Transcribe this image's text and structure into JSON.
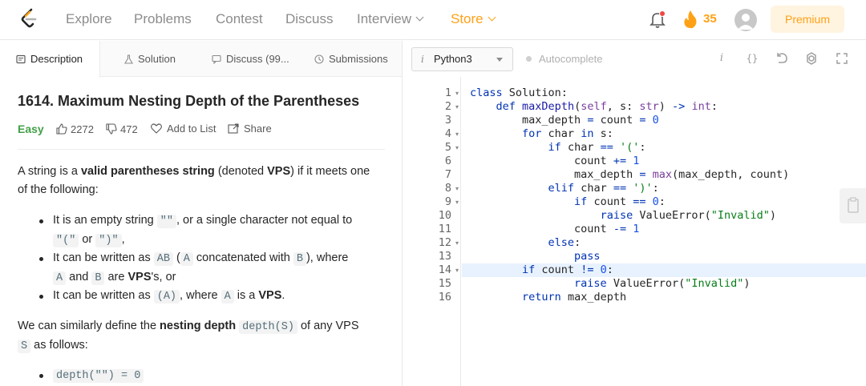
{
  "nav": {
    "items": [
      "Explore",
      "Problems",
      "Contest",
      "Discuss"
    ],
    "interview": "Interview",
    "store": "Store",
    "streak": "35",
    "premium": "Premium"
  },
  "tabs": {
    "description": "Description",
    "solution": "Solution",
    "discuss": "Discuss (99...",
    "submissions": "Submissions"
  },
  "problem": {
    "title": "1614. Maximum Nesting Depth of the Parentheses",
    "difficulty": "Easy",
    "likes": "2272",
    "dislikes": "472",
    "add_to_list": "Add to List",
    "share": "Share"
  },
  "description": {
    "p1_a": "A string is a ",
    "p1_b": "valid parentheses string",
    "p1_c": " (denoted ",
    "p1_d": "VPS",
    "p1_e": ") if it meets one of the following:",
    "b1_a": "It is an empty string ",
    "b1_code1": "\"\"",
    "b1_b": ", or a single character not equal to ",
    "b1_code2": "\"(\"",
    "b1_or": " or ",
    "b1_code3": "\")\"",
    "b1_end": ",",
    "b2_a": "It can be written as ",
    "b2_code1": "AB",
    "b2_b": " (",
    "b2_code2": "A",
    "b2_c": " concatenated with ",
    "b2_code3": "B",
    "b2_d": "), where ",
    "b2_code4": "A",
    "b2_and": " and ",
    "b2_code5": "B",
    "b2_e": " are ",
    "b2_vps": "VPS",
    "b2_f": "'s, or",
    "b3_a": "It can be written as ",
    "b3_code1": "(A)",
    "b3_b": ", where ",
    "b3_code2": "A",
    "b3_c": " is a ",
    "b3_vps": "VPS",
    "b3_d": ".",
    "p2_a": "We can similarly define the ",
    "p2_b": "nesting depth",
    "p2_code1": "depth(S)",
    "p2_c": " of any VPS ",
    "p2_code2": "S",
    "p2_d": " as follows:",
    "b4_code": "depth(\"\") = 0"
  },
  "editor": {
    "language": "Python3",
    "autocomplete": "Autocomplete",
    "line_numbers": [
      "1",
      "2",
      "3",
      "4",
      "5",
      "6",
      "7",
      "8",
      "9",
      "10",
      "11",
      "12",
      "13",
      "14",
      "15",
      "16"
    ]
  }
}
